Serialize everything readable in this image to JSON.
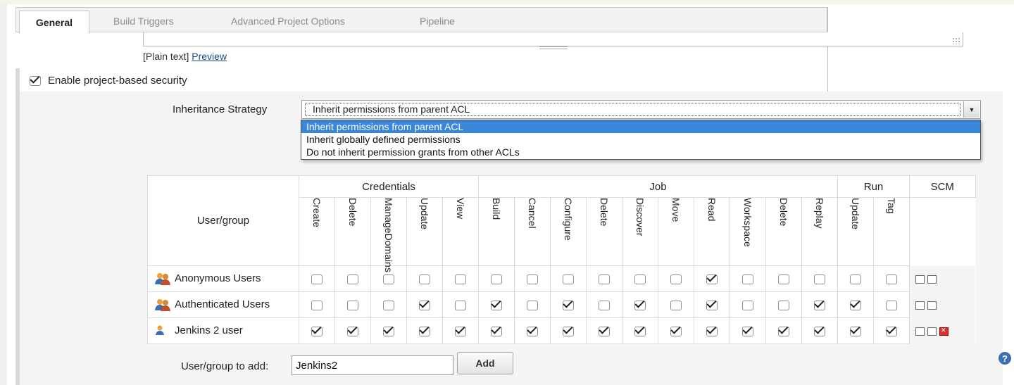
{
  "tabs": [
    {
      "label": "General",
      "active": true
    },
    {
      "label": "Build Triggers",
      "active": false
    },
    {
      "label": "Advanced Project Options",
      "active": false
    },
    {
      "label": "Pipeline",
      "active": false
    }
  ],
  "description": {
    "plain_text_label": "[Plain text]",
    "preview_link": "Preview"
  },
  "security": {
    "enable_label": "Enable project-based security",
    "enabled": true,
    "strategy_label": "Inheritance Strategy",
    "strategy_selected": "Inherit permissions from parent ACL",
    "strategy_options": [
      "Inherit permissions from parent ACL",
      "Inherit globally defined permissions",
      "Do not inherit permission grants from other ACLs"
    ],
    "strategy_highlighted_index": 0
  },
  "matrix": {
    "user_group_header": "User/group",
    "groups": [
      {
        "label": "Credentials",
        "span": 5
      },
      {
        "label": "Job",
        "span": 10
      },
      {
        "label": "Run",
        "span": 2
      },
      {
        "label": "SCM",
        "span": 1
      }
    ],
    "permissions": [
      "Create",
      "Delete",
      "ManageDomains",
      "Update",
      "View",
      "Build",
      "Cancel",
      "Configure",
      "Delete",
      "Discover",
      "Move",
      "Read",
      "Workspace",
      "Delete",
      "Replay",
      "Update",
      "Tag"
    ],
    "rows": [
      {
        "name": "Anonymous Users",
        "icon": "group-icon",
        "checks": [
          false,
          false,
          false,
          false,
          false,
          false,
          false,
          false,
          false,
          false,
          false,
          true,
          false,
          false,
          false,
          false,
          false
        ],
        "deletable": false
      },
      {
        "name": "Authenticated Users",
        "icon": "group-icon",
        "checks": [
          false,
          false,
          false,
          true,
          false,
          true,
          false,
          true,
          false,
          true,
          false,
          true,
          false,
          false,
          true,
          true,
          false
        ],
        "deletable": false
      },
      {
        "name": "Jenkins 2 user",
        "icon": "user-icon",
        "checks": [
          true,
          true,
          true,
          true,
          true,
          true,
          true,
          true,
          true,
          true,
          true,
          true,
          true,
          true,
          true,
          true,
          true
        ],
        "deletable": true
      }
    ]
  },
  "add_user": {
    "label": "User/group to add:",
    "value": "Jenkins2",
    "button": "Add"
  },
  "help_icon_glyph": "?"
}
